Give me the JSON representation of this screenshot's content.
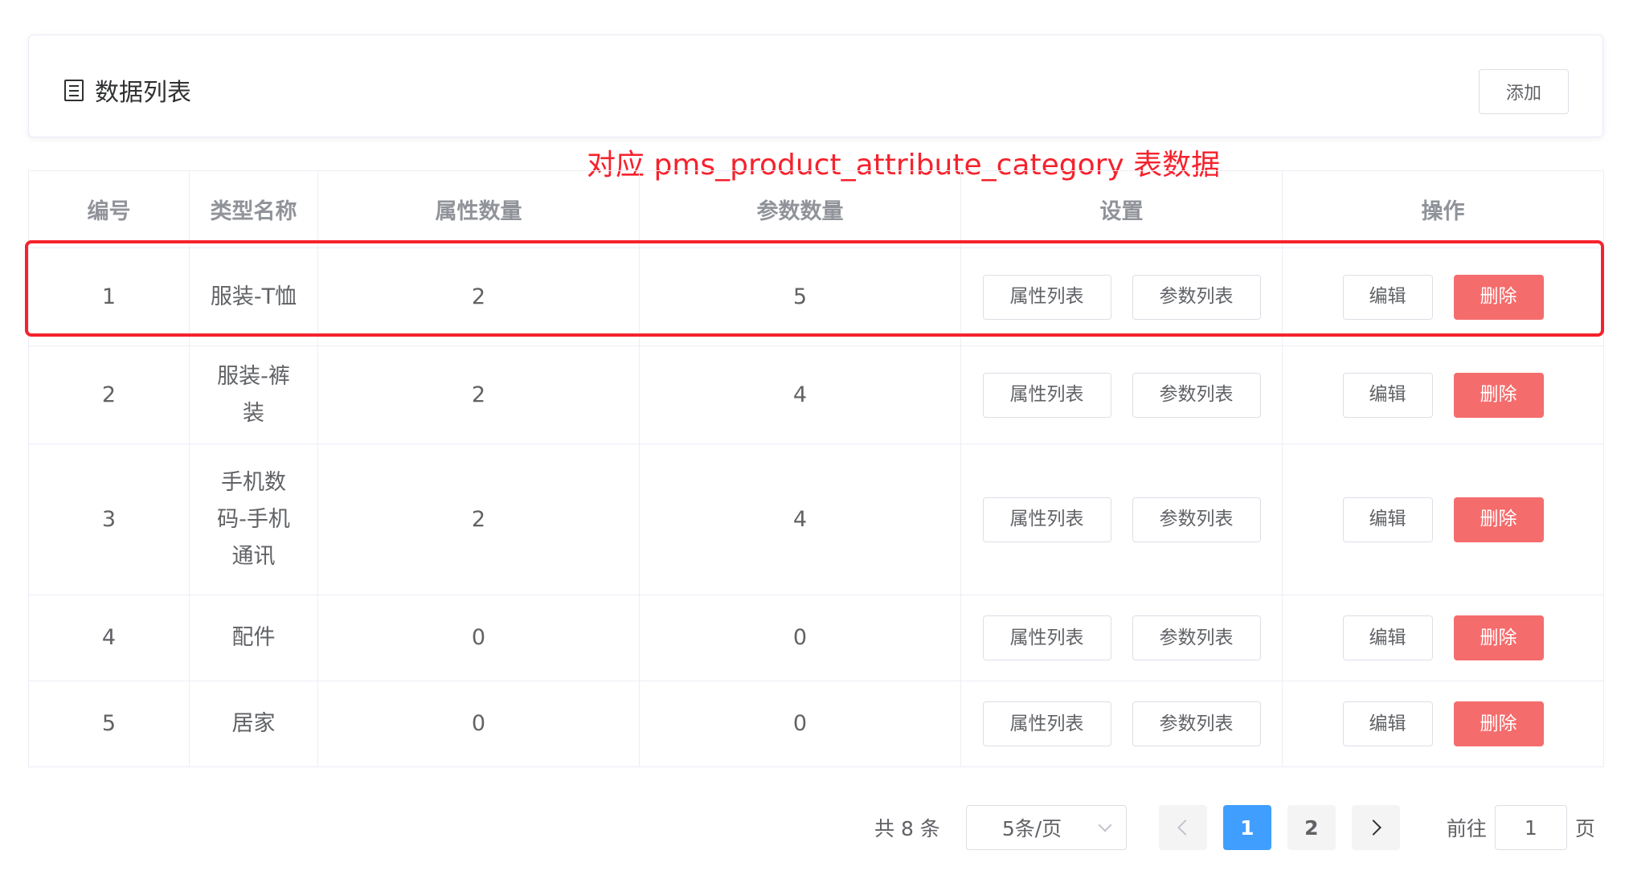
{
  "header": {
    "title": "数据列表",
    "add_label": "添加"
  },
  "annotation": "对应 pms_product_attribute_category 表数据",
  "table": {
    "columns": [
      "编号",
      "类型名称",
      "属性数量",
      "参数数量",
      "设置",
      "操作"
    ],
    "rows": [
      {
        "id": "1",
        "name": "服装-T恤",
        "attr_count": "2",
        "param_count": "5"
      },
      {
        "id": "2",
        "name": "服装-裤装",
        "attr_count": "2",
        "param_count": "4"
      },
      {
        "id": "3",
        "name": "手机数码-手机通讯",
        "attr_count": "2",
        "param_count": "4"
      },
      {
        "id": "4",
        "name": "配件",
        "attr_count": "0",
        "param_count": "0"
      },
      {
        "id": "5",
        "name": "居家",
        "attr_count": "0",
        "param_count": "0"
      }
    ],
    "buttons": {
      "attr_list": "属性列表",
      "param_list": "参数列表",
      "edit": "编辑",
      "delete": "删除"
    }
  },
  "pagination": {
    "total": "共 8 条",
    "page_size": "5条/页",
    "pages": [
      "1",
      "2"
    ],
    "current": "1",
    "goto_prefix": "前往",
    "goto_value": "1",
    "goto_suffix": "页"
  },
  "colors": {
    "primary": "#409eff",
    "danger": "#f56c6c",
    "annotation": "#f5222d"
  }
}
